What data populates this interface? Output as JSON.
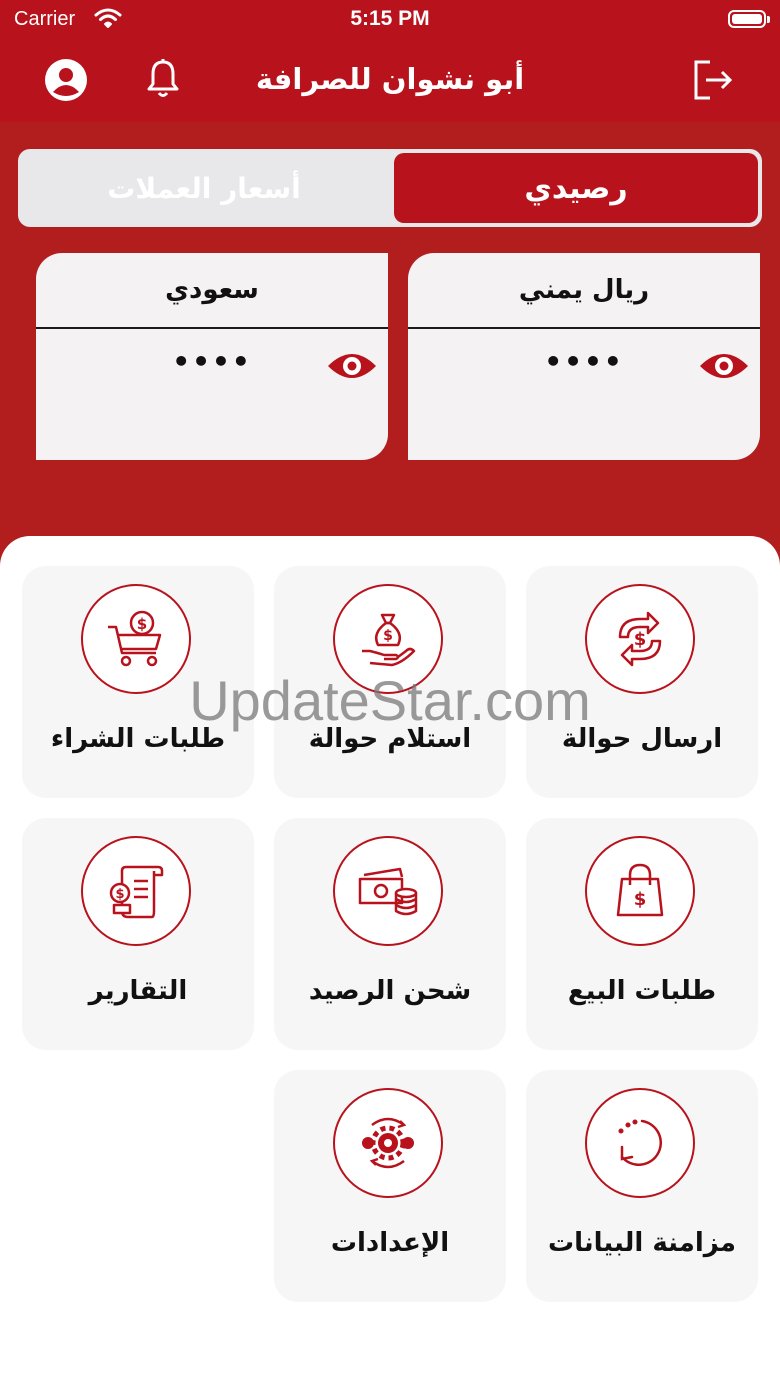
{
  "status_bar": {
    "carrier": "Carrier",
    "time": "5:15 PM"
  },
  "header": {
    "title": "أبو نشوان للصرافة"
  },
  "tabs": {
    "active": "رصيدي",
    "inactive": "أسعار العملات"
  },
  "balances": [
    {
      "currency": "ريال يمني",
      "amount": "••••"
    },
    {
      "currency": "سعودي",
      "amount": "••••"
    }
  ],
  "menu": [
    {
      "label": "ارسال حوالة",
      "icon": "money-transfer-icon"
    },
    {
      "label": "استلام حوالة",
      "icon": "receive-money-icon"
    },
    {
      "label": "طلبات الشراء",
      "icon": "shopping-cart-icon"
    },
    {
      "label": "طلبات البيع",
      "icon": "shopping-bag-icon"
    },
    {
      "label": "شحن الرصيد",
      "icon": "cash-coins-icon"
    },
    {
      "label": "التقارير",
      "icon": "report-scroll-icon"
    },
    {
      "label": "مزامنة البيانات",
      "icon": "sync-icon"
    },
    {
      "label": "الإعدادات",
      "icon": "settings-gears-icon"
    }
  ],
  "watermark": "UpdateStar.com",
  "colors": {
    "primary": "#b8121c",
    "tile_bg": "#f6f6f6"
  }
}
